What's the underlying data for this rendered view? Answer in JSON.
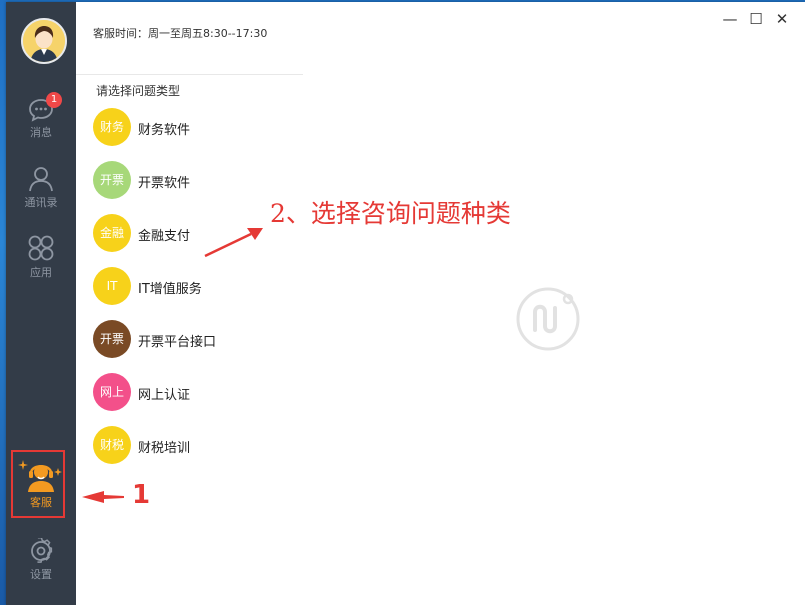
{
  "sidebar": {
    "messages": {
      "label": "消息",
      "badge": "1"
    },
    "contacts": {
      "label": "通讯录"
    },
    "apps": {
      "label": "应用"
    },
    "support": {
      "label": "客服"
    },
    "settings": {
      "label": "设置"
    }
  },
  "panel": {
    "service_hours": "客服时间：周一至周五8:30--17:30",
    "section_title": "请选择问题类型",
    "categories": [
      {
        "badge": "财务",
        "label": "财务软件",
        "color": "#f7d21a"
      },
      {
        "badge": "开票",
        "label": "开票软件",
        "color": "#a7d879"
      },
      {
        "badge": "金融",
        "label": "金融支付",
        "color": "#f7d21a"
      },
      {
        "badge": "IT",
        "label": "IT增值服务",
        "color": "#f7d21a"
      },
      {
        "badge": "开票",
        "label": "开票平台接口",
        "color": "#7a4a25"
      },
      {
        "badge": "网上",
        "label": "网上认证",
        "color": "#f3508a"
      },
      {
        "badge": "财税",
        "label": "财税培训",
        "color": "#f7d21a"
      }
    ]
  },
  "window": {
    "minimize": "—",
    "maximize": "☐",
    "close": "✕"
  },
  "annotations": {
    "step2": "2、选择咨询问题种类",
    "step1": "1"
  },
  "colors": {
    "sidebar": "#333c48",
    "accent": "#f39a21",
    "annotation": "#e53935"
  }
}
